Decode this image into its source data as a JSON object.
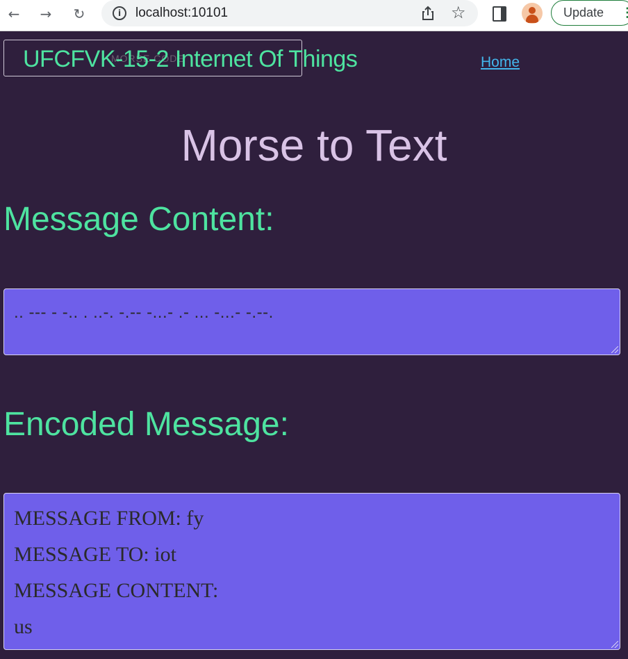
{
  "browser": {
    "url": "localhost:10101",
    "update_label": "Update"
  },
  "header": {
    "brand_shadow": "MORSE CODE",
    "brand": "UFCFVK-15-2 Internet Of Things",
    "home_link": "Home"
  },
  "page": {
    "title": "Morse to Text",
    "message_content_label": "Message Content:",
    "morse_input": ".. --- - -.. . ..-. -.-- -...- .- ... -...- -.--.",
    "encoded_label": "Encoded Message:",
    "encoded_lines": [
      "MESSAGE FROM: fy",
      "MESSAGE TO: iot",
      "MESSAGE CONTENT:",
      "us"
    ]
  },
  "colors": {
    "background": "#2f1f3d",
    "accent_green": "#4ee3a0",
    "title_lavender": "#d9c3e6",
    "box_purple": "#6f5fea",
    "link_blue": "#43b6ec"
  }
}
